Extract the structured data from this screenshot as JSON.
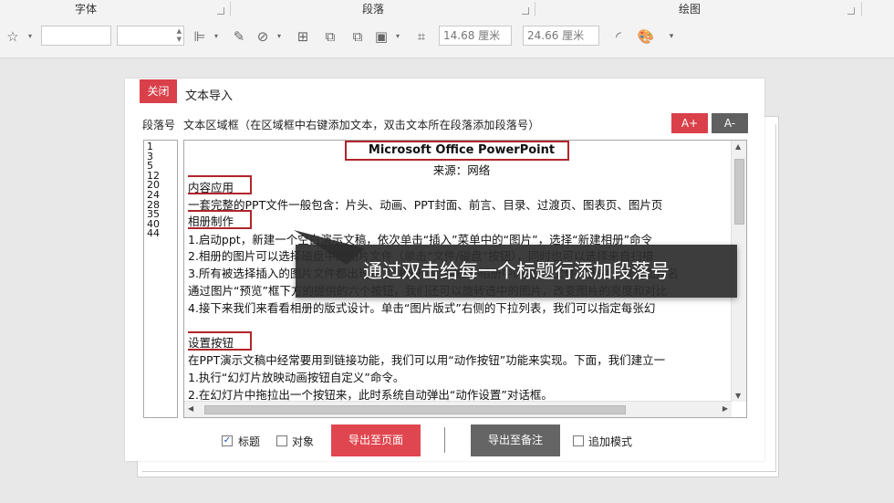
{
  "ribbon": {
    "groups": [
      "字体",
      "段落",
      "绘图"
    ],
    "shape_width": "14.68 厘米",
    "shape_height": "24.66 厘米"
  },
  "panel": {
    "close_label": "关闭",
    "title": "文本导入",
    "col_label": "段落号",
    "area_label": "文本区域框（在区域框中右键添加文本，双击文本所在段落添加段落号）",
    "font_increase": "A+",
    "font_decrease": "A-"
  },
  "paragraph_numbers": [
    "1",
    "3",
    "5",
    "12",
    "20",
    "24",
    "28",
    "35",
    "40",
    "44"
  ],
  "text_lines": [
    "Microsoft Office PowerPoint",
    "来源：网络",
    "内容应用",
    "一套完整的PPT文件一般包含：片头、动画、PPT封面、前言、目录、过渡页、图表页、图片页",
    "相册制作",
    "1.启动ppt，新建一个空白演示文稿，依次单击“插入”菜单中的“图片”，选择“新建相册”命令",
    "2.相册的图片可以选择磁盘中的图片文件（单击“文件/磁盘”按钮），同时也可以选择来自扫描",
    "3.所有被选择插入的图片文件都出现在了“相册”对话框的“相册中的图片”文件列表中，单击图片名",
    "通过图片“预览”框下方的提供的六个按钮，我们还可以旋转选中的图片，改变图片的亮度和对比",
    "4.接下来我们来看看相册的版式设计。单击“图片版式”右侧的下拉列表，我们可以指定每张幻",
    "设置按钮",
    "在PPT演示文稿中经常要用到链接功能，我们可以用“动作按钮”功能来实现。下面，我们建立一",
    "1.执行“幻灯片放映动画按钮自定义”命令。",
    "2.在幻灯片中拖拉出一个按钮来，此时系统自动弹出“动作设置”对话框。"
  ],
  "bottom": {
    "chk_title_label": "标题",
    "chk_title_checked": true,
    "chk_object_label": "对象",
    "chk_object_checked": false,
    "export_page": "导出至页面",
    "export_note": "导出至备注",
    "chk_append_label": "追加模式",
    "chk_append_checked": false
  },
  "callout": "通过双击给每一个标题行添加段落号",
  "colors": {
    "accent_red": "#d9404a",
    "highlight_border": "#b0252c",
    "dark_button": "#656565"
  }
}
